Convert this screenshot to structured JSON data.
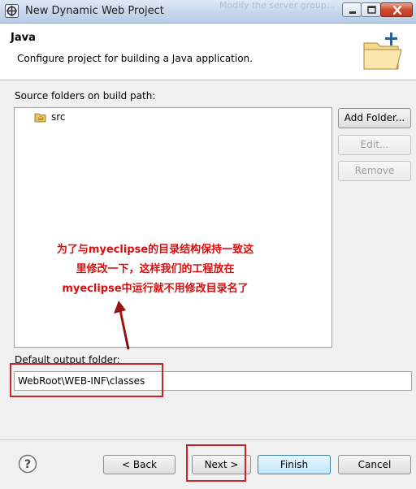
{
  "window": {
    "title": "New Dynamic Web Project",
    "background_partial_text": "Modify the server group..."
  },
  "header": {
    "title": "Java",
    "description": "Configure project for building a Java application."
  },
  "source_folders": {
    "label": "Source folders on build path:",
    "items": [
      {
        "name": "src",
        "icon": "package-folder-icon"
      }
    ]
  },
  "side_buttons": {
    "add": "Add Folder...",
    "edit": "Edit...",
    "remove": "Remove"
  },
  "annotation": {
    "lines": [
      "为了与myeclipse的目录结构保持一致这",
      "里修改一下，这样我们的工程放在",
      "myeclipse中运行就不用修改目录名了"
    ],
    "color": "#d81010"
  },
  "output": {
    "label": "Default output folder:",
    "value": "WebRoot\\WEB-INF\\classes"
  },
  "footer": {
    "back": "< Back",
    "next": "Next >",
    "finish": "Finish",
    "cancel": "Cancel"
  },
  "colors": {
    "highlight_box": "#c9242a",
    "primary_button_border": "#3c7fb1"
  }
}
